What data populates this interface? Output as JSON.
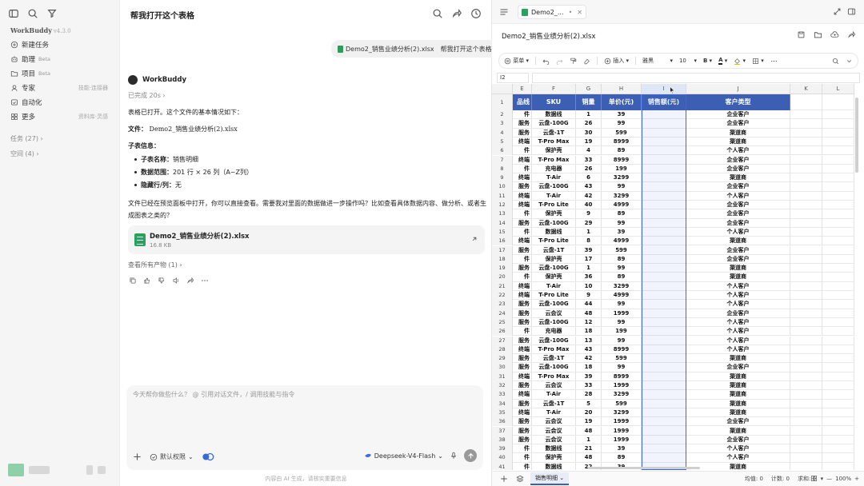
{
  "sidebar": {
    "brand": "WorkBuddy",
    "version": "v4.3.0",
    "items": [
      {
        "label": "新建任务",
        "icon": "plus-circle-icon",
        "tag": "",
        "right": ""
      },
      {
        "label": "助理",
        "icon": "robot-icon",
        "tag": "Beta",
        "right": ""
      },
      {
        "label": "项目",
        "icon": "folder-icon",
        "tag": "Beta",
        "right": ""
      },
      {
        "label": "专家",
        "icon": "expert-icon",
        "tag": "",
        "right": "技能·连接器"
      },
      {
        "label": "自动化",
        "icon": "calendar-check-icon",
        "tag": "",
        "right": ""
      },
      {
        "label": "更多",
        "icon": "grid-icon",
        "tag": "",
        "right": "资料库·灵感"
      }
    ],
    "groups": [
      {
        "label": "任务 (27)"
      },
      {
        "label": "空间 (4)"
      }
    ]
  },
  "chat": {
    "title": "帮我打开这个表格",
    "user_message": {
      "file": "Demo2_销售业绩分析(2).xlsx",
      "text": "帮我打开这个表格"
    },
    "bot_name": "WorkBuddy",
    "done_label": "已完成 20s",
    "intro": "表格已打开。这个文件的基本情况如下：",
    "file_label": "文件：",
    "file_value": "Demo2_销售业绩分析(2).xlsx",
    "sheet_info_title": "子表信息：",
    "bullets": [
      {
        "key": "子表名称：",
        "value": "销售明细"
      },
      {
        "key": "数据范围：",
        "value": "201 行 × 26 列（A~Z列）"
      },
      {
        "key": "隐藏行/列：",
        "value": "无"
      }
    ],
    "paragraph_line1": "文件已经在预览面板中打开，你可以直接查看。需要我对里面的数据做进一步操作吗？比如查看具体数据内容、做分析、或者生",
    "paragraph_line2": "成图表之类的？",
    "file_card": {
      "name": "Demo2_销售业绩分析(2).xlsx",
      "size": "16.8 KB"
    },
    "view_all": "查看所有产物 (1)",
    "input_placeholder": "今天帮你做些什么？  @ 引用对话文件，/ 调用技能与指令",
    "permission_label": "默认权限",
    "model_label": "Deepseek-V4-Flash",
    "footer_note": "内容由 AI 生成，请核实重要信息"
  },
  "preview": {
    "tab_label": "Demo2_...",
    "file_title": "Demo2_销售业绩分析(2).xlsx",
    "toolbar": {
      "menu": "菜单",
      "insert": "插入",
      "font": "雅黑",
      "font_size": "10"
    },
    "name_box": "I2",
    "column_letters": [
      "E",
      "F",
      "G",
      "H",
      "I",
      "J",
      "K",
      "L"
    ],
    "headers": [
      "品线",
      "SKU",
      "销量",
      "单价(元)",
      "销售额(元)",
      "客户类型"
    ],
    "rows": [
      [
        "件",
        "数据线",
        "1",
        "39",
        "",
        "企业客户"
      ],
      [
        "服务",
        "云盘-100G",
        "26",
        "99",
        "",
        "企业客户"
      ],
      [
        "服务",
        "云盘-1T",
        "30",
        "599",
        "",
        "渠道商"
      ],
      [
        "终端",
        "T-Pro Max",
        "19",
        "8999",
        "",
        "渠道商"
      ],
      [
        "件",
        "保护壳",
        "4",
        "89",
        "",
        "个人客户"
      ],
      [
        "终端",
        "T-Pro Max",
        "33",
        "8999",
        "",
        "企业客户"
      ],
      [
        "件",
        "充电器",
        "26",
        "199",
        "",
        "企业客户"
      ],
      [
        "终端",
        "T-Air",
        "6",
        "3299",
        "",
        "渠道商"
      ],
      [
        "服务",
        "云盘-100G",
        "43",
        "99",
        "",
        "企业客户"
      ],
      [
        "终端",
        "T-Air",
        "42",
        "3299",
        "",
        "个人客户"
      ],
      [
        "终端",
        "T-Pro Lite",
        "40",
        "4999",
        "",
        "企业客户"
      ],
      [
        "件",
        "保护壳",
        "9",
        "89",
        "",
        "企业客户"
      ],
      [
        "服务",
        "云盘-100G",
        "29",
        "99",
        "",
        "企业客户"
      ],
      [
        "件",
        "数据线",
        "1",
        "39",
        "",
        "个人客户"
      ],
      [
        "终端",
        "T-Pro Lite",
        "8",
        "4999",
        "",
        "渠道商"
      ],
      [
        "服务",
        "云盘-1T",
        "39",
        "599",
        "",
        "企业客户"
      ],
      [
        "件",
        "保护壳",
        "17",
        "89",
        "",
        "企业客户"
      ],
      [
        "服务",
        "云盘-100G",
        "1",
        "99",
        "",
        "渠道商"
      ],
      [
        "件",
        "保护壳",
        "36",
        "89",
        "",
        "渠道商"
      ],
      [
        "终端",
        "T-Air",
        "10",
        "3299",
        "",
        "个人客户"
      ],
      [
        "终端",
        "T-Pro Lite",
        "9",
        "4999",
        "",
        "个人客户"
      ],
      [
        "服务",
        "云盘-100G",
        "44",
        "99",
        "",
        "个人客户"
      ],
      [
        "服务",
        "云会议",
        "48",
        "1999",
        "",
        "企业客户"
      ],
      [
        "服务",
        "云盘-100G",
        "12",
        "99",
        "",
        "个人客户"
      ],
      [
        "件",
        "充电器",
        "18",
        "199",
        "",
        "个人客户"
      ],
      [
        "服务",
        "云盘-100G",
        "13",
        "99",
        "",
        "个人客户"
      ],
      [
        "终端",
        "T-Pro Max",
        "43",
        "8999",
        "",
        "个人客户"
      ],
      [
        "服务",
        "云盘-1T",
        "42",
        "599",
        "",
        "渠道商"
      ],
      [
        "服务",
        "云盘-100G",
        "18",
        "99",
        "",
        "企业客户"
      ],
      [
        "终端",
        "T-Pro Max",
        "39",
        "8999",
        "",
        "渠道商"
      ],
      [
        "服务",
        "云会议",
        "33",
        "1999",
        "",
        "渠道商"
      ],
      [
        "终端",
        "T-Air",
        "28",
        "3299",
        "",
        "渠道商"
      ],
      [
        "服务",
        "云盘-1T",
        "5",
        "599",
        "",
        "渠道商"
      ],
      [
        "终端",
        "T-Air",
        "20",
        "3299",
        "",
        "渠道商"
      ],
      [
        "服务",
        "云会议",
        "19",
        "1999",
        "",
        "企业客户"
      ],
      [
        "服务",
        "云会议",
        "48",
        "1999",
        "",
        "渠道商"
      ],
      [
        "服务",
        "云会议",
        "1",
        "1999",
        "",
        "企业客户"
      ],
      [
        "件",
        "数据线",
        "21",
        "39",
        "",
        "个人客户"
      ],
      [
        "件",
        "保护壳",
        "48",
        "89",
        "",
        "个人客户"
      ],
      [
        "件",
        "数据线",
        "22",
        "39",
        "",
        "渠道商"
      ]
    ],
    "sheet_tab": "销售明细",
    "stats": {
      "avg": "均值: 0",
      "count": "计数: 0",
      "sum": "求和: 0"
    },
    "zoom": "100%"
  },
  "colors": {
    "header_bg": "#3d5fb3",
    "selection": "#3b68d6",
    "excel_green": "#27a35d"
  }
}
